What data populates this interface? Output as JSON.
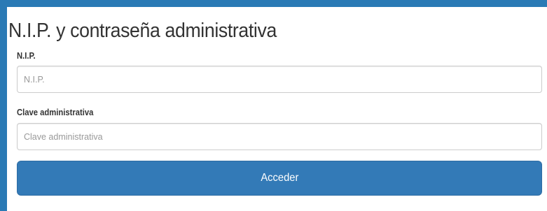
{
  "form": {
    "title": "N.I.P. y contraseña administrativa",
    "nip_label": "N.I.P.",
    "nip_placeholder": "N.I.P.",
    "nip_value": "",
    "clave_label": "Clave administrativa",
    "clave_placeholder": "Clave administrativa",
    "clave_value": "",
    "submit_label": "Acceder"
  },
  "colors": {
    "page_background": "#2a7ab5",
    "primary_button": "#337ab7"
  }
}
